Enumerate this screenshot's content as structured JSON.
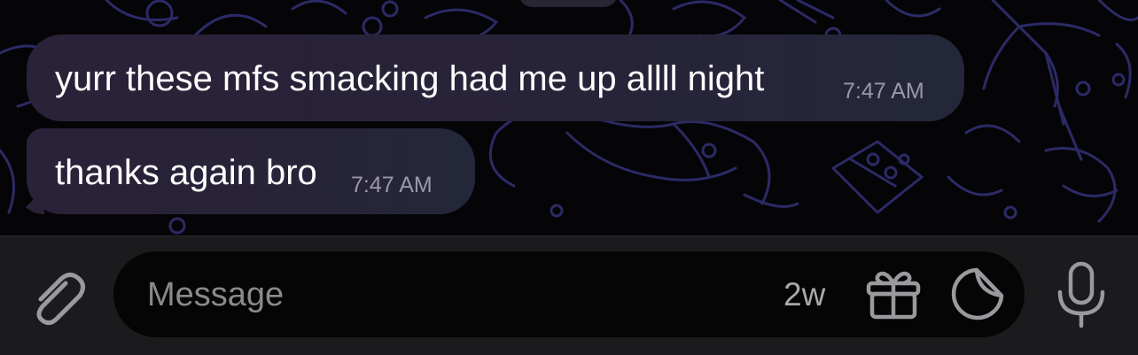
{
  "messages": [
    {
      "text": "yurr these mfs smacking had me up allll night",
      "time": "7:47 AM"
    },
    {
      "text": "thanks again bro",
      "time": "7:47 AM"
    }
  ],
  "composer": {
    "placeholder": "Message",
    "timer": "2w"
  },
  "icons": {
    "attach": "paperclip-icon",
    "gift": "gift-icon",
    "sticker": "sticker-icon",
    "mic": "microphone-icon"
  },
  "colors": {
    "background": "#050507",
    "bubble": "#2a2238",
    "doodle_stroke": "#2c2a66",
    "bubble_text": "#ffffff",
    "timestamp": "#9a98a8",
    "input_bar": "#1b1b1d",
    "icon": "#9a9a9e"
  }
}
